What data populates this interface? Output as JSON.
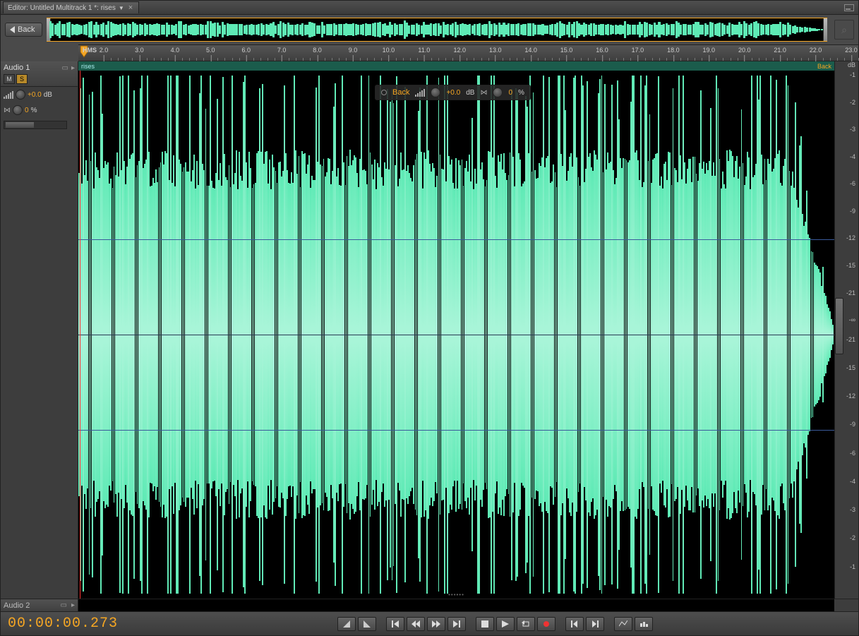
{
  "tab": {
    "title": "Editor: Untitled Multitrack 1 *: rises"
  },
  "nav": {
    "back": "Back"
  },
  "ruler": {
    "unit": "HMS",
    "start": 2.0,
    "end": 23.0,
    "step": 1.0
  },
  "track1": {
    "name": "Audio 1",
    "mute": "M",
    "solo": "S",
    "gain": "+0.0",
    "gain_unit": "dB",
    "pan": "0",
    "pan_unit": "%"
  },
  "clip": {
    "name": "rises",
    "right": "Back"
  },
  "hud": {
    "back": "Back",
    "gain": "+0.0",
    "gain_unit": "dB",
    "pan": "0",
    "pan_unit": "%"
  },
  "dbscale": {
    "unit": "dB",
    "top": [
      "-1",
      "-2",
      "-3",
      "-4",
      "-6",
      "-9",
      "-12",
      "-15",
      "-21",
      "-∞"
    ],
    "bot": [
      "-21",
      "-15",
      "-12",
      "-9",
      "-6",
      "-4",
      "-3",
      "-2",
      "-1"
    ]
  },
  "track2": {
    "name": "Audio 2"
  },
  "timecode": "00:00:00.273",
  "colors": {
    "accent": "#f5a623",
    "wave": "#5eeab5"
  },
  "waveform_seed": 1234
}
